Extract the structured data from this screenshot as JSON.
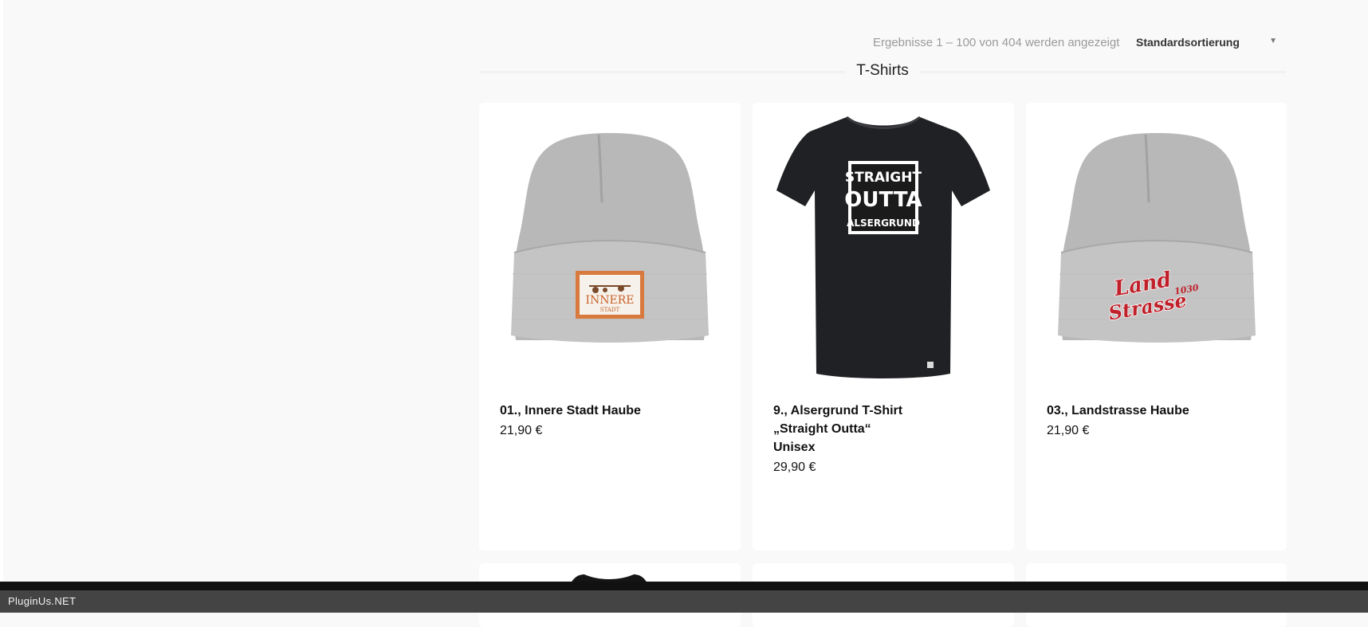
{
  "toolbar": {
    "result_count": "Ergebnisse 1 – 100 von 404 werden angezeigt",
    "orderby_selected": "Standardsortierung"
  },
  "section": {
    "title": "T-Shirts"
  },
  "products": [
    {
      "title": "01., Innere Stadt Haube",
      "price": "21,90 €",
      "image": "grey-beanie-innere-stadt",
      "patch_line1": "INNERE",
      "patch_line2": "STADT"
    },
    {
      "title_line1": "9., Alsergrund T-Shirt",
      "title_line2": "„Straight Outta“",
      "title_line3": "Unisex",
      "price": "29,90 €",
      "image": "black-tshirt-straight-outta",
      "print_line1": "STRAIGHT",
      "print_line2": "OUTTA",
      "print_line3": "ALSERGRUND"
    },
    {
      "title": "03., Landstrasse Haube",
      "price": "21,90 €",
      "image": "grey-beanie-landstrasse",
      "logo_line1": "Land",
      "logo_line2": "Strasse",
      "logo_number": "1030"
    }
  ],
  "footer": {
    "label": "PluginUs.NET"
  }
}
